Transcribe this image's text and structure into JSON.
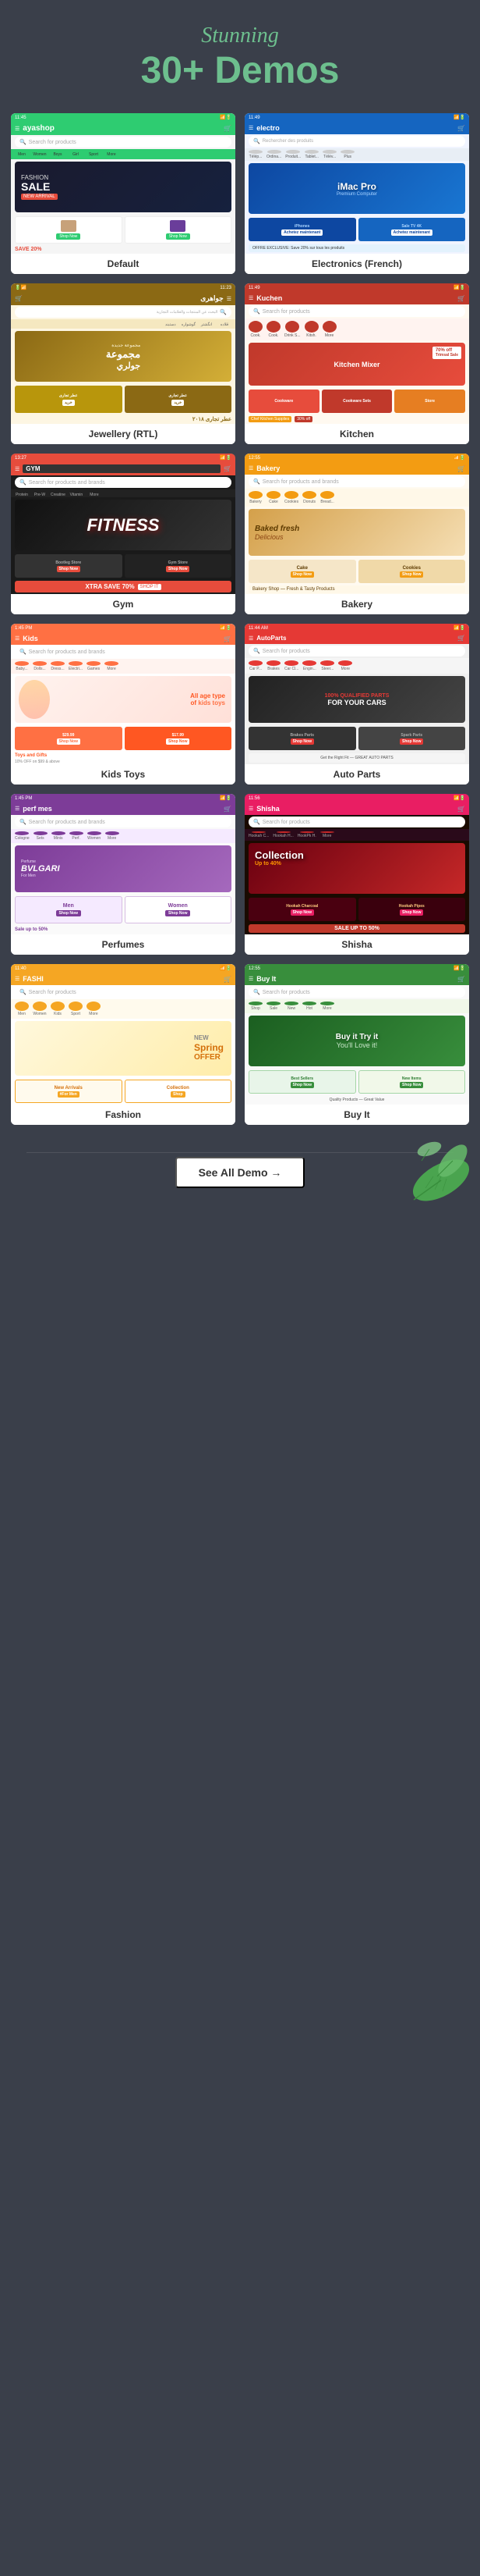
{
  "header": {
    "stunning": "Stunning",
    "demos_count": "30+",
    "demos_label": " Demos"
  },
  "demos": [
    {
      "id": "default",
      "label": "Default",
      "theme_color": "#2ecc71",
      "logo": "ayashop",
      "search_placeholder": "Search for products",
      "banner_text": "FASHION\nSALE",
      "sub_text": "NEW ARRI..."
    },
    {
      "id": "electronics",
      "label": "Electronics (French)",
      "theme_color": "#1565c0",
      "logo": "electro",
      "search_placeholder": "Rechercher des produits",
      "banner_text": "iMac Pro"
    },
    {
      "id": "jewellery",
      "label": "Jewellery (RTL)",
      "theme_color": "#8B6914",
      "logo": "جواهری",
      "search_placeholder": "البحث عن المنتجات والعلامات التجارية",
      "banner_text": "مجموعة\nجولري"
    },
    {
      "id": "kitchen",
      "label": "Kitchen",
      "theme_color": "#c0392b",
      "logo": "Kuchen",
      "search_placeholder": "Search for products",
      "banner_text": "Chef Kitchen Supplies",
      "sale_text": "30%"
    },
    {
      "id": "gym",
      "label": "Gym",
      "theme_color": "#e74c3c",
      "logo": "GYM",
      "search_placeholder": "Search for products and brands",
      "banner_text": "FITNESS"
    },
    {
      "id": "bakery",
      "label": "Bakery",
      "theme_color": "#f39c12",
      "logo": "Bakery",
      "search_placeholder": "Search for products and brands",
      "banner_text": "Baked fresh\nDelicious"
    },
    {
      "id": "kids",
      "label": "Kids Toys",
      "theme_color": "#ff7043",
      "logo": "Kids",
      "search_placeholder": "Search for products and brands",
      "banner_text": "All age type\nof kids toys",
      "sub_text": "Toys and Gifts\n10% OFF on $99 & above"
    },
    {
      "id": "auto",
      "label": "Auto Parts",
      "theme_color": "#e53935",
      "logo": "AutoParts",
      "search_placeholder": "Search for products",
      "banner_text": "100% QUALIFIED PARTS\nFOR YOUR CARS"
    },
    {
      "id": "perfumes",
      "label": "Perfumes",
      "theme_color": "#8e44ad",
      "logo": "perf mes",
      "search_placeholder": "Search for products and brands",
      "banner_text": "BVLGARI",
      "sub_text": "Sale up to 50%"
    },
    {
      "id": "shisha",
      "label": "Shisha",
      "theme_color": "#e91e63",
      "logo": "Shisha",
      "search_placeholder": "Search for products",
      "banner_text": "Collection",
      "sub_text": "Up to 40%"
    },
    {
      "id": "fashion",
      "label": "Fashion",
      "theme_color": "#ffcc00",
      "logo": "FASHI",
      "search_placeholder": "Search for products",
      "banner_text": "NEW\nSpring\nOFFER"
    },
    {
      "id": "buyit",
      "label": "Buy It",
      "theme_color": "#4caf50",
      "logo": "Buy It",
      "search_placeholder": "Search for products",
      "banner_text": "Buy it Try it\nYou'll Love it!"
    }
  ],
  "see_all": {
    "label": "See All Demo →"
  }
}
